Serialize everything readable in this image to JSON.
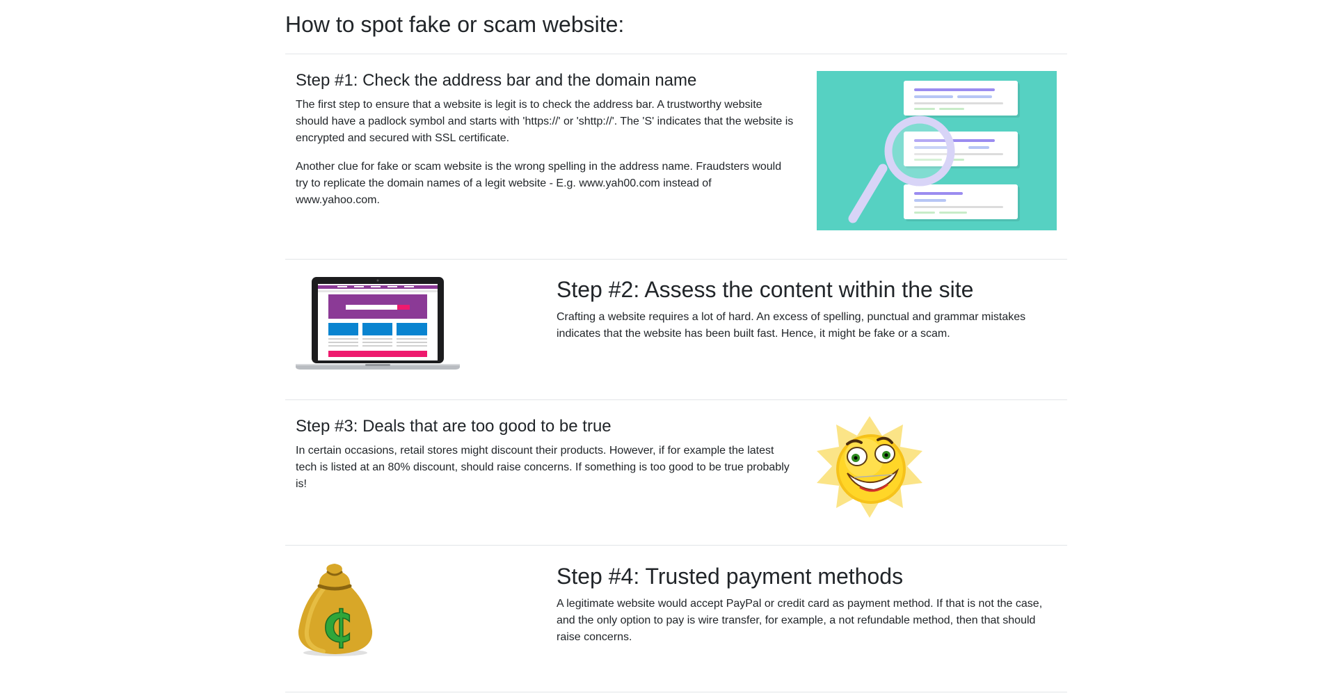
{
  "page": {
    "title": "How to spot fake or scam website:"
  },
  "steps": [
    {
      "title": "Step #1: Check the address bar and the domain name",
      "paragraphs": [
        "The first step to ensure that a website is legit is to check the address bar. A trustworthy website should have a padlock symbol and starts with 'https://' or 'shttp://'. The 'S' indicates that the website is encrypted and secured with SSL certificate.",
        "Another clue for fake or scam website is the wrong spelling in the address name. Fraudsters would try to replicate the domain names of a legit website - E.g. www.yah00.com instead of www.yahoo.com."
      ],
      "image": "magnifier-search-results-icon"
    },
    {
      "title": "Step #2: Assess the content within the site",
      "paragraphs": [
        "Crafting a website requires a lot of hard. An excess of spelling, punctual and grammar mistakes indicates that the website has been built fast. Hence, it might be fake or a scam."
      ],
      "image": "laptop-website-icon"
    },
    {
      "title": "Step #3: Deals that are too good to be true",
      "paragraphs": [
        "In certain occasions, retail stores might discount their products. However, if for example the latest tech is listed at an 80% discount, should raise concerns. If something is too good to be true probably is!"
      ],
      "image": "crazy-sun-emoji-icon"
    },
    {
      "title": "Step #4: Trusted payment methods",
      "paragraphs": [
        "A legitimate website would accept PayPal or credit card as payment method. If that is not the case, and the only option to pay is wire transfer, for example, a not refundable method, then that should raise concerns."
      ],
      "image": "money-bag-icon",
      "image_symbol": "₵"
    }
  ],
  "colors": {
    "text": "#212529",
    "divider": "#e2e5e8",
    "teal": "#56d1c2",
    "purple": "#8b3a96",
    "pink": "#ee1a6e",
    "blue": "#0a84d0",
    "sun": "#ffd21f",
    "bag": "#d8a728",
    "bag_symbol": "#2fa63a"
  }
}
